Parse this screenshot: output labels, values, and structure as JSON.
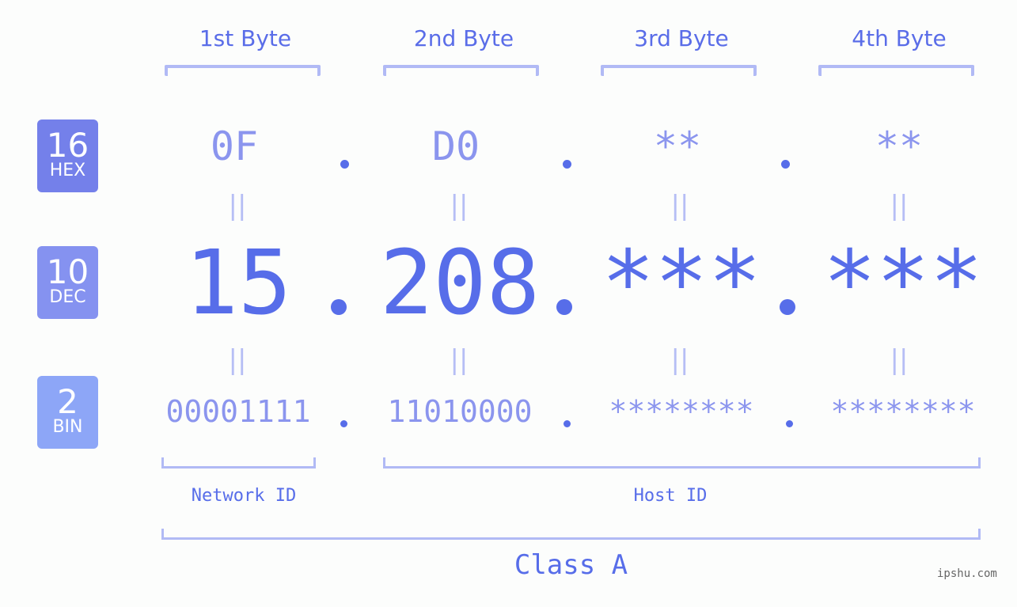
{
  "byte_headers": [
    "1st Byte",
    "2nd Byte",
    "3rd Byte",
    "4th Byte"
  ],
  "rows": {
    "hex": {
      "badge_number": "16",
      "badge_label": "HEX",
      "badge_color": "#7480ea",
      "values": [
        "0F",
        "D0",
        "**",
        "**"
      ]
    },
    "dec": {
      "badge_number": "10",
      "badge_label": "DEC",
      "badge_color": "#8592f0",
      "values": [
        "15",
        "208",
        "***",
        "***"
      ]
    },
    "bin": {
      "badge_number": "2",
      "badge_label": "BIN",
      "badge_color": "#8da6f7",
      "values": [
        "00001111",
        "11010000",
        "********",
        "********"
      ]
    }
  },
  "equals_symbol": "||",
  "network_id_label": "Network ID",
  "host_id_label": "Host ID",
  "class_label": "Class A",
  "watermark": "ipshu.com",
  "colors": {
    "accent": "#576de9",
    "light": "#8b95ee",
    "bracket": "#b1baf5"
  }
}
